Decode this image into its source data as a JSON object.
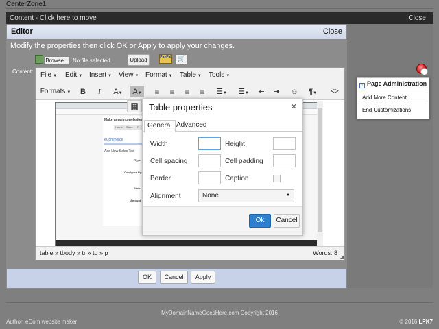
{
  "zone": {
    "label": "CenterZone1"
  },
  "content_bar": {
    "label": "Content - Click here to move",
    "close": "Close"
  },
  "editor": {
    "title": "Editor",
    "close": "Close",
    "instructions": "Modify the properties then click OK or Apply to apply your changes.",
    "content_label": "Content:",
    "browse": "Browse...",
    "no_file": "No file selected.",
    "upload": "Upload",
    "paypal": "PayPal",
    "buttons": {
      "ok": "OK",
      "cancel": "Cancel",
      "apply": "Apply"
    }
  },
  "tinymce": {
    "menus": [
      "File",
      "Edit",
      "Insert",
      "View",
      "Format",
      "Table",
      "Tools"
    ],
    "formats": "Formats",
    "statusbar": {
      "path": "table » tbody » tr » td » p",
      "words": "Words: 8"
    }
  },
  "embedded_screenshot": {
    "heading": "Make amazing websites,",
    "nav": [
      "Home",
      "Store",
      "P"
    ],
    "section": "eCommerce",
    "form_title": "Add New Sales Tax",
    "labels": [
      "Type:",
      "Configure By:",
      "State:",
      "Amount:"
    ]
  },
  "table_dialog": {
    "title": "Table properties",
    "tabs": [
      "General",
      "Advanced"
    ],
    "fields": {
      "width": "Width",
      "height": "Height",
      "cell_spacing": "Cell spacing",
      "cell_padding": "Cell padding",
      "border": "Border",
      "caption": "Caption",
      "alignment": "Alignment"
    },
    "alignment_value": "None",
    "ok": "Ok",
    "cancel": "Cancel"
  },
  "page_admin": {
    "title": "Page Administration",
    "items": [
      "Add More Content",
      "End Customizations"
    ]
  },
  "footer": {
    "copyright": "MyDomainNameGoesHere.com Copyright 2016",
    "author": "Author: eCom website maker",
    "lpk_prefix": "© 2016",
    "lpk_brand": "LPK7"
  }
}
